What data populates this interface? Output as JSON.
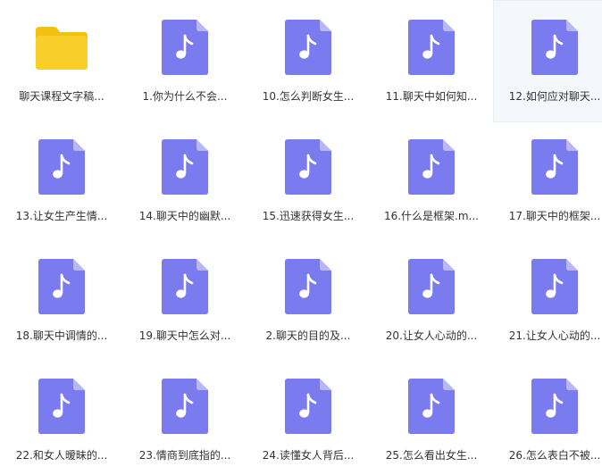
{
  "colors": {
    "audio_icon": "#7b7bf0",
    "audio_icon_fold": "#b6b6f9",
    "folder_back": "#f2c10f",
    "folder_front": "#f7ce2a",
    "selected_bg": "#f4f8fd"
  },
  "items": [
    {
      "label": "聊天课程文字稿...",
      "type": "folder",
      "icon": "folder-icon"
    },
    {
      "label": "1.你为什么不会...",
      "type": "audio",
      "icon": "music-file-icon"
    },
    {
      "label": "10.怎么判断女生...",
      "type": "audio",
      "icon": "music-file-icon"
    },
    {
      "label": "11.聊天中如何知...",
      "type": "audio",
      "icon": "music-file-icon"
    },
    {
      "label": "12.如何应对聊天...",
      "type": "audio",
      "icon": "music-file-icon",
      "selected": true
    },
    {
      "label": "13.让女生产生情...",
      "type": "audio",
      "icon": "music-file-icon"
    },
    {
      "label": "14.聊天中的幽默...",
      "type": "audio",
      "icon": "music-file-icon"
    },
    {
      "label": "15.迅速获得女生...",
      "type": "audio",
      "icon": "music-file-icon"
    },
    {
      "label": "16.什么是框架.m...",
      "type": "audio",
      "icon": "music-file-icon"
    },
    {
      "label": "17.聊天中的框架...",
      "type": "audio",
      "icon": "music-file-icon"
    },
    {
      "label": "18.聊天中调情的...",
      "type": "audio",
      "icon": "music-file-icon"
    },
    {
      "label": "19.聊天中怎么对...",
      "type": "audio",
      "icon": "music-file-icon"
    },
    {
      "label": "2.聊天的目的及...",
      "type": "audio",
      "icon": "music-file-icon"
    },
    {
      "label": "20.让女人心动的...",
      "type": "audio",
      "icon": "music-file-icon"
    },
    {
      "label": "21.让女人心动的...",
      "type": "audio",
      "icon": "music-file-icon"
    },
    {
      "label": "22.和女人暧昧的...",
      "type": "audio",
      "icon": "music-file-icon"
    },
    {
      "label": "23.情商到底指的...",
      "type": "audio",
      "icon": "music-file-icon"
    },
    {
      "label": "24.读懂女人背后...",
      "type": "audio",
      "icon": "music-file-icon"
    },
    {
      "label": "25.怎么看出女生...",
      "type": "audio",
      "icon": "music-file-icon"
    },
    {
      "label": "26.怎么表白不被...",
      "type": "audio",
      "icon": "music-file-icon"
    }
  ]
}
